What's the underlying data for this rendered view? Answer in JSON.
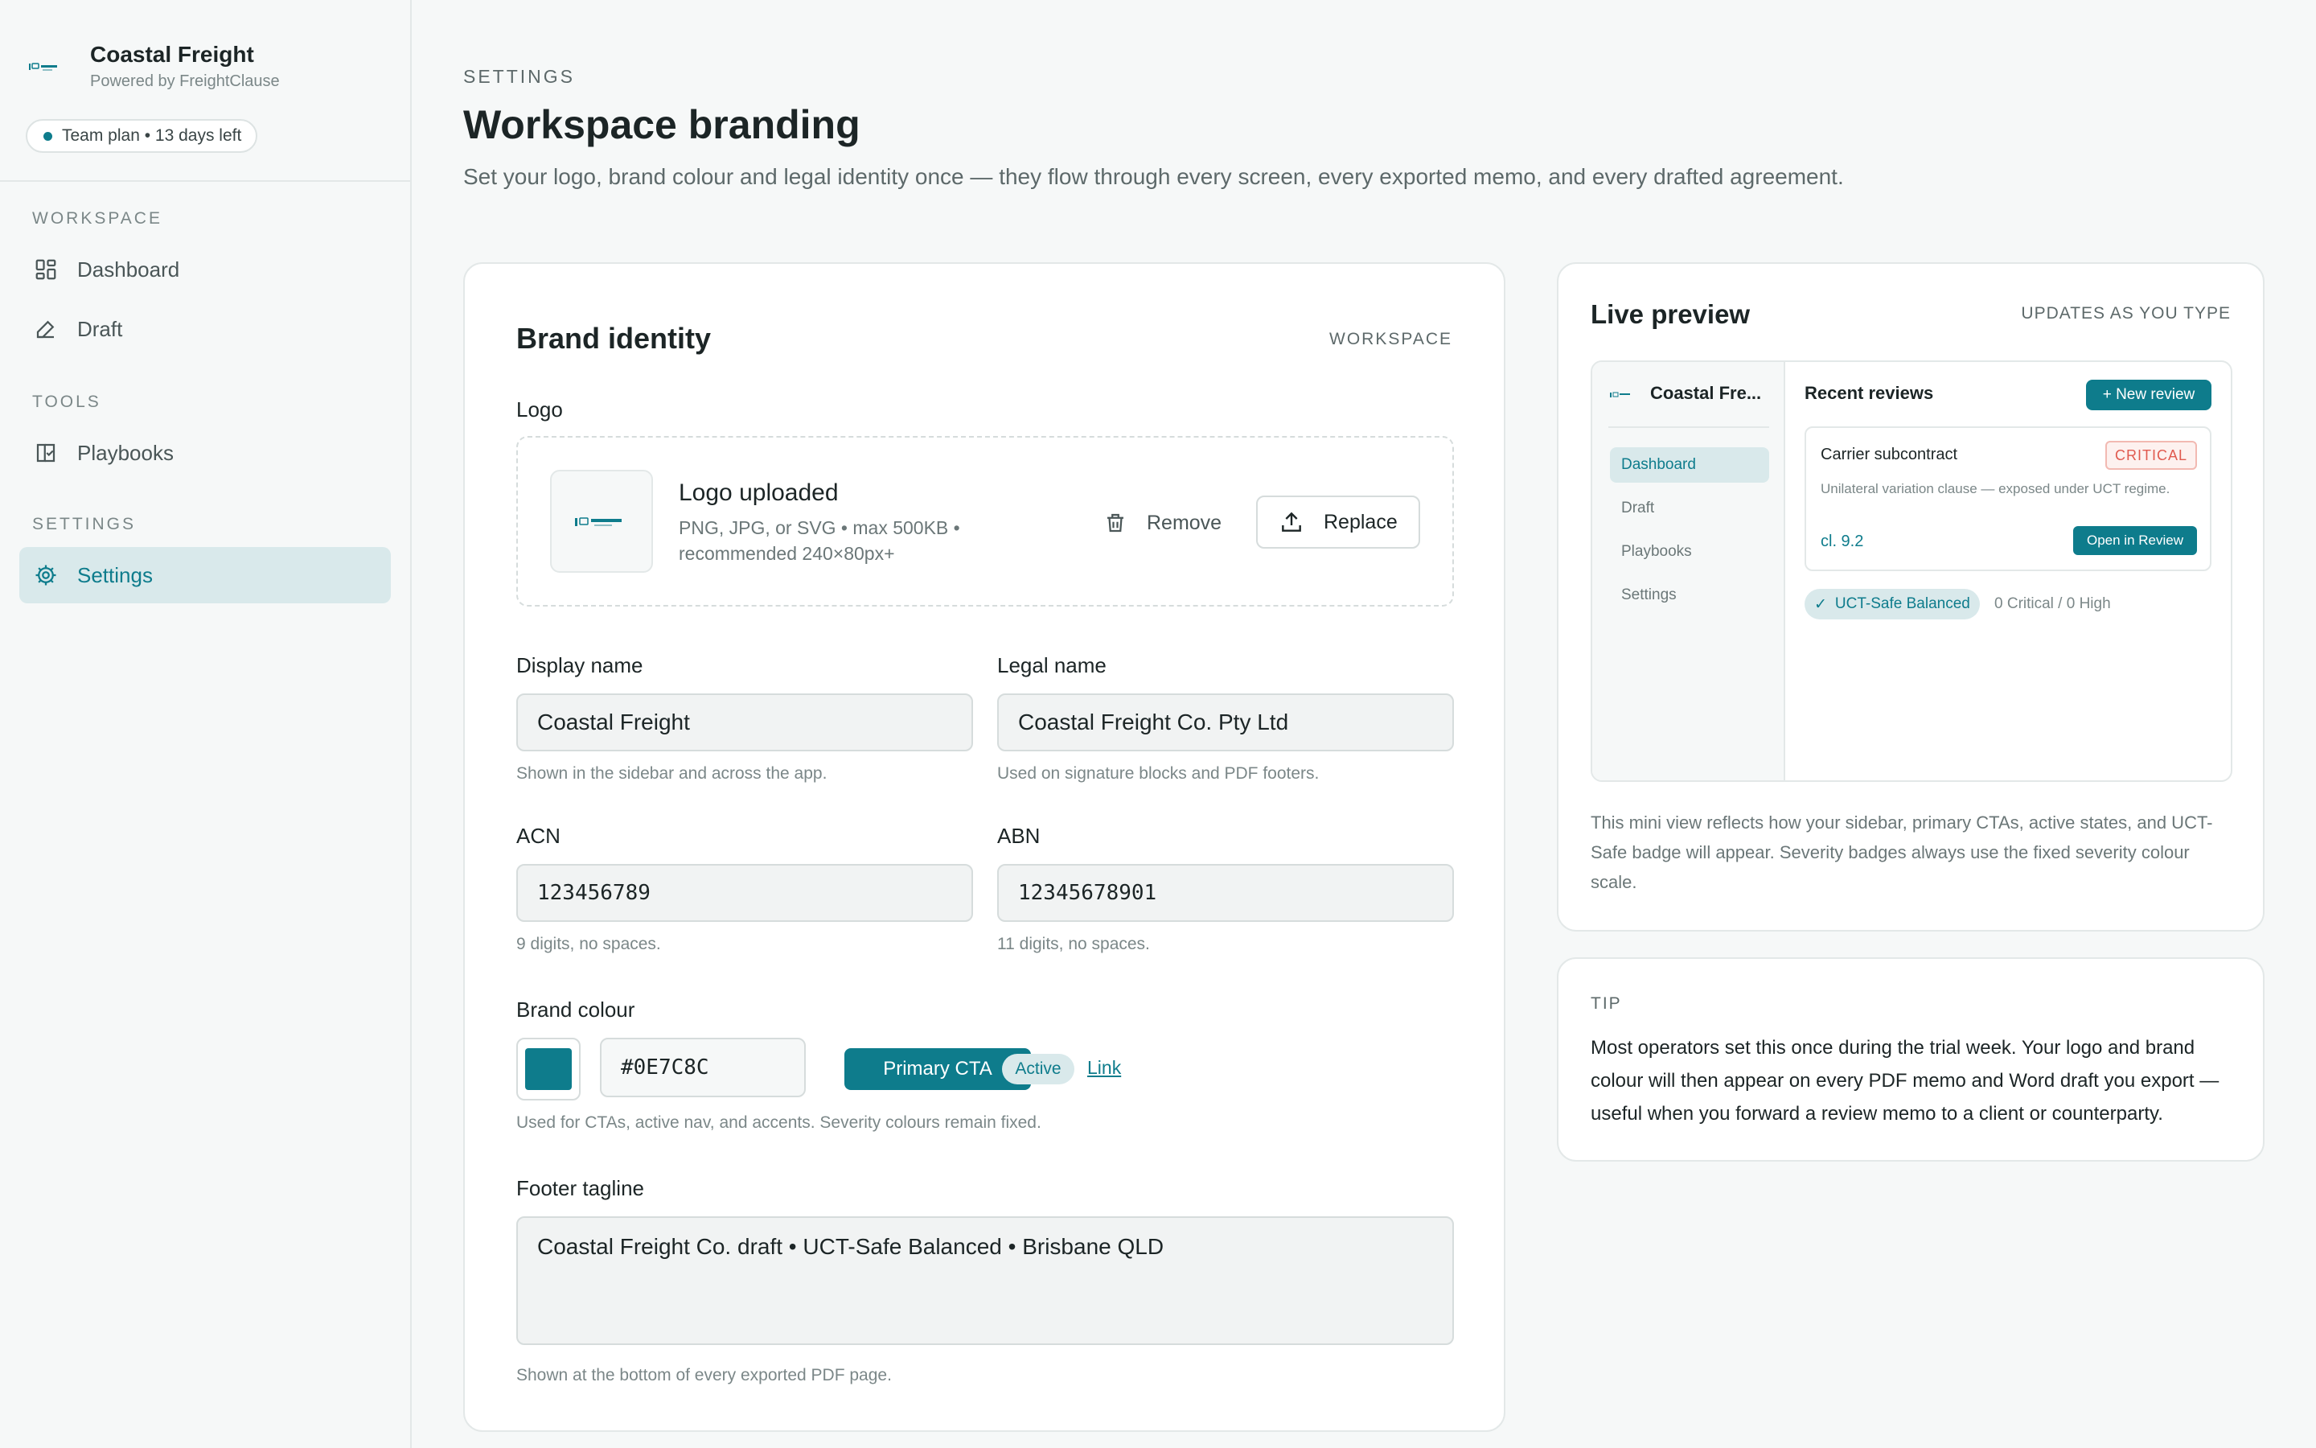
{
  "sidebar": {
    "app_name": "Coastal Freight",
    "powered_by": "Powered by FreightClause",
    "trial_badge": "Team plan • 13 days left",
    "sections": {
      "workspace": "WORKSPACE",
      "tools": "TOOLS",
      "settings": "SETTINGS"
    },
    "items": [
      {
        "label": "Dashboard",
        "icon": "dashboard-icon"
      },
      {
        "label": "Draft",
        "icon": "pen-icon"
      },
      {
        "label": "Playbooks",
        "icon": "book-icon"
      },
      {
        "label": "Settings",
        "icon": "gear-icon",
        "active": true
      }
    ]
  },
  "header": {
    "eyebrow": "SETTINGS",
    "title": "Workspace branding",
    "description": "Set your logo, brand colour and legal identity once — they flow through every screen, every exported memo, and every drafted agreement."
  },
  "brand_identity": {
    "title": "Brand identity",
    "tag": "WORKSPACE",
    "logo_label": "Logo",
    "logo_status": "Logo uploaded",
    "logo_hint": "PNG, JPG, or SVG • max 500KB • recommended 240×80px+",
    "remove_label": "Remove",
    "replace_label": "Replace",
    "display_name": {
      "label": "Display name",
      "value": "Coastal Freight",
      "help": "Shown in the sidebar and across the app."
    },
    "legal_name": {
      "label": "Legal name",
      "value": "Coastal Freight Co. Pty Ltd",
      "help": "Used on signature blocks and PDF footers."
    },
    "acn": {
      "label": "ACN",
      "value": "123456789",
      "help": "9 digits, no spaces."
    },
    "abn": {
      "label": "ABN",
      "value": "12345678901",
      "help": "11 digits, no spaces."
    },
    "brand_colour": {
      "label": "Brand colour",
      "value": "#0E7C8C",
      "sample_cta": "Primary CTA",
      "sample_active": "Active",
      "sample_link": "Link",
      "help": "Used for CTAs, active nav, and accents. Severity colours remain fixed."
    },
    "footer_tagline": {
      "label": "Footer tagline",
      "value": "Coastal Freight Co. draft • UCT-Safe Balanced • Brisbane QLD",
      "help": "Shown at the bottom of every exported PDF page."
    }
  },
  "preview": {
    "title": "Live preview",
    "tag": "UPDATES AS YOU TYPE",
    "app_name": "Coastal Fre...",
    "nav": [
      "Dashboard",
      "Draft",
      "Playbooks",
      "Settings"
    ],
    "recent_title": "Recent reviews",
    "new_review": "+ New review",
    "review": {
      "title": "Carrier subcontract",
      "severity": "CRITICAL",
      "desc": "Unilateral variation clause — exposed under UCT regime.",
      "clause": "cl. 9.2",
      "action": "Open in Review"
    },
    "badge": "UCT-Safe Balanced",
    "counts": "0 Critical / 0 High",
    "note": "This mini view reflects how your sidebar, primary CTAs, active states, and UCT-Safe badge will appear. Severity badges always use the fixed severity colour scale."
  },
  "tip": {
    "tag": "TIP",
    "text": "Most operators set this once during the trial week. Your logo and brand colour will then appear on every PDF memo and Word draft you export — useful when you forward a review memo to a client or counterparty."
  },
  "colors": {
    "brand": "#0E7C8C",
    "critical": "#e05a4f",
    "background": "#f6f8f8"
  }
}
